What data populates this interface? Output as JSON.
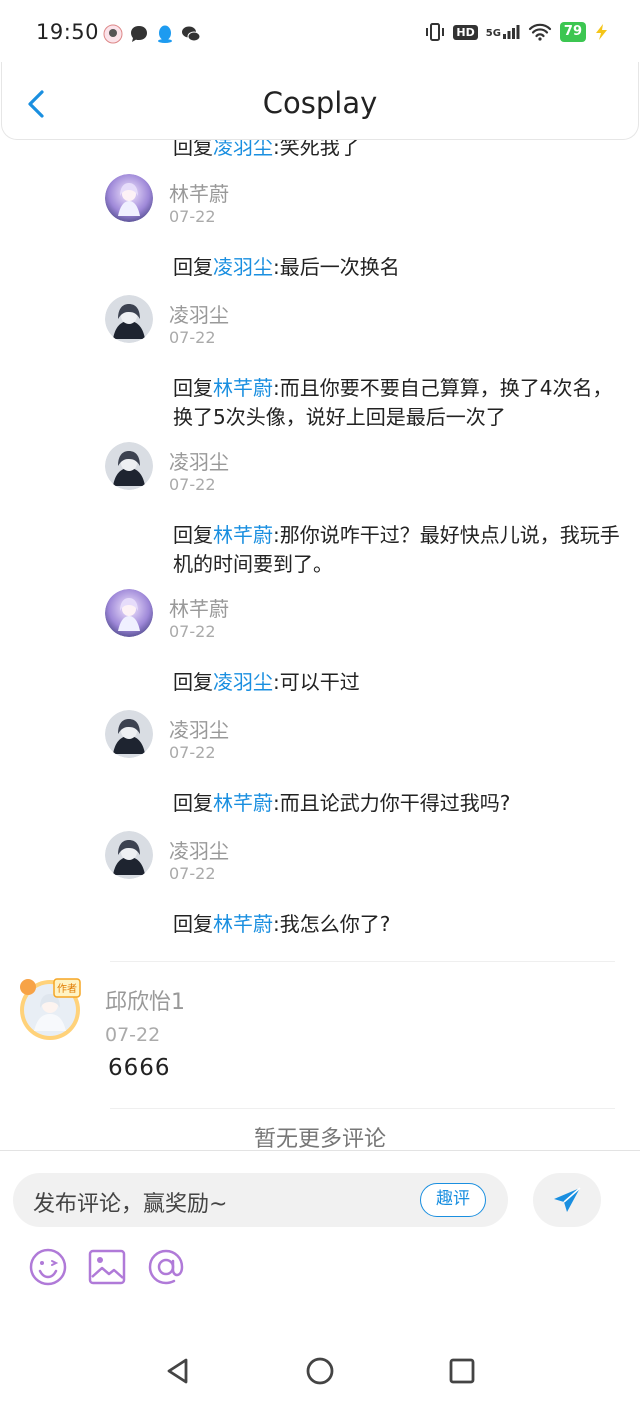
{
  "status_bar": {
    "time": "19:50",
    "network": "5G",
    "battery": "79"
  },
  "header": {
    "title": "Cosplay"
  },
  "replies": [
    {
      "type": "text",
      "prefix": "回复",
      "mention": "凌羽尘",
      "text": ":笑死我了"
    },
    {
      "type": "user",
      "name": "林芊蔚",
      "date": "07-22",
      "avatar": "purple"
    },
    {
      "type": "text",
      "prefix": "回复",
      "mention": "凌羽尘",
      "text": ":最后一次换名"
    },
    {
      "type": "user",
      "name": "凌羽尘",
      "date": "07-22",
      "avatar": "dark"
    },
    {
      "type": "text",
      "prefix": "回复",
      "mention": "林芊蔚",
      "text": ":而且你要不要自己算算，换了4次名，换了5次头像，说好上回是最后一次了"
    },
    {
      "type": "user",
      "name": "凌羽尘",
      "date": "07-22",
      "avatar": "dark"
    },
    {
      "type": "text",
      "prefix": "回复",
      "mention": "林芊蔚",
      "text": ":那你说咋干过？最好快点儿说，我玩手机的时间要到了。"
    },
    {
      "type": "user",
      "name": "林芊蔚",
      "date": "07-22",
      "avatar": "purple"
    },
    {
      "type": "text",
      "prefix": "回复",
      "mention": "凌羽尘",
      "text": ":可以干过"
    },
    {
      "type": "user",
      "name": "凌羽尘",
      "date": "07-22",
      "avatar": "dark"
    },
    {
      "type": "text",
      "prefix": "回复",
      "mention": "林芊蔚",
      "text": ":而且论武力你干得过我吗?"
    },
    {
      "type": "user",
      "name": "凌羽尘",
      "date": "07-22",
      "avatar": "dark"
    },
    {
      "type": "text",
      "prefix": "回复",
      "mention": "林芊蔚",
      "text": ":我怎么你了?"
    }
  ],
  "author_comment": {
    "badge": "作者",
    "name": "邱欣怡1",
    "date": "07-22",
    "text": "6666"
  },
  "footer_note": "暂无更多评论",
  "input": {
    "placeholder": "发布评论，赢奖励~",
    "fun_button": "趣评"
  },
  "colors": {
    "mention": "#1a8fe0",
    "accent": "#1a8fe0",
    "tool_icons": "#b07ad8",
    "battery": "#3cc651"
  },
  "icons": [
    "back-icon",
    "send-icon",
    "emoji-icon",
    "image-icon",
    "at-icon",
    "nav-back-icon",
    "nav-home-icon",
    "nav-recents-icon"
  ]
}
